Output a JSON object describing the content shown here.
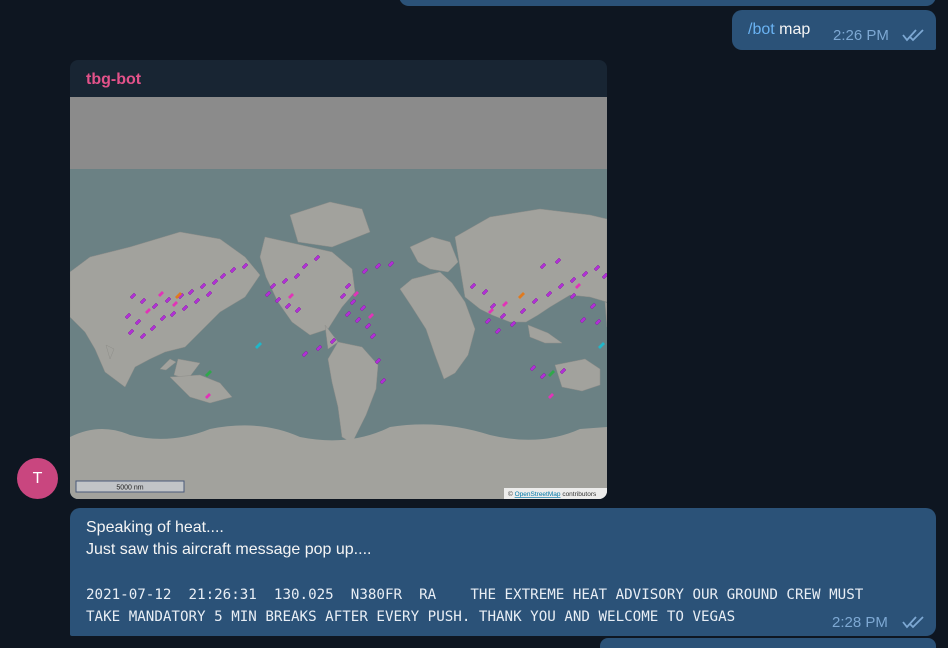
{
  "outgoing": {
    "command": "/bot",
    "arg": "map",
    "time": "2:26 PM",
    "status_icon": "double-check-icon"
  },
  "photo_message": {
    "sender": "tbg-bot",
    "map": {
      "scale_label": "5000 nm",
      "attribution_prefix": "©",
      "attribution_link": "OpenStreetMap",
      "attribution_suffix": "contributors",
      "colors": {
        "ocean": "#6b8184",
        "land": "#a2a29d",
        "polar": "#929292",
        "aircraft": "#b12fd6"
      }
    }
  },
  "avatar": {
    "letter": "T",
    "color": "#c9467f"
  },
  "incoming": {
    "lines": [
      "Speaking of heat....",
      "Just saw this aircraft message pop up...."
    ],
    "message_lines": [
      "2021-07-12  21:26:31  130.025  N380FR  RA    THE EXTREME HEAT ADVISORY OUR GROUND CREW MUST",
      "TAKE MANDATORY 5 MIN BREAKS AFTER EVERY PUSH. THANK YOU AND WELCOME TO VEGAS"
    ],
    "time": "2:28 PM",
    "status_icon": "double-check-icon"
  }
}
